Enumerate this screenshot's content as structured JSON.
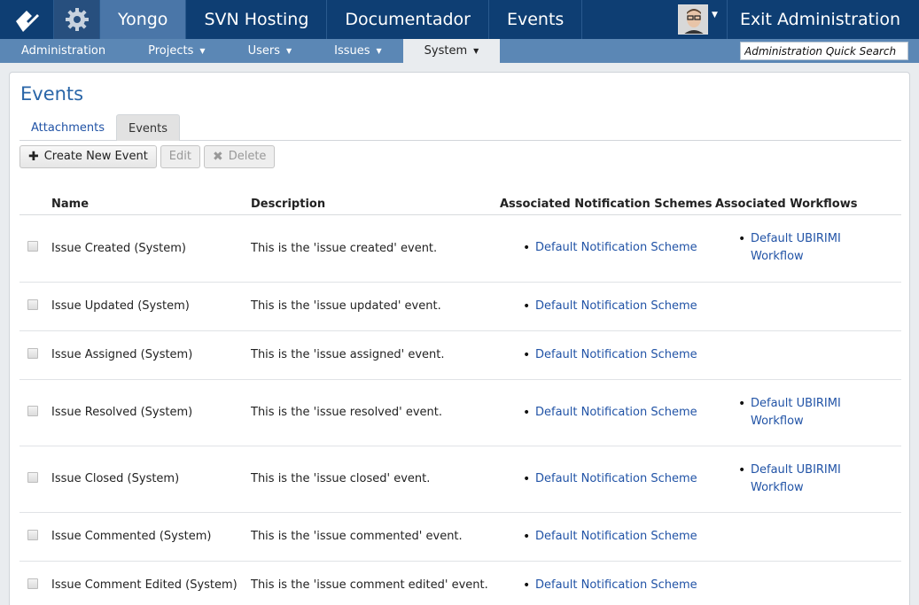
{
  "topbar": {
    "nav": [
      "Yongo",
      "SVN Hosting",
      "Documentador",
      "Events"
    ],
    "active_nav": "Yongo",
    "exit_label": "Exit Administration"
  },
  "subbar": {
    "items": [
      {
        "label": "Administration",
        "dropdown": false
      },
      {
        "label": "Projects",
        "dropdown": true
      },
      {
        "label": "Users",
        "dropdown": true
      },
      {
        "label": "Issues",
        "dropdown": true
      },
      {
        "label": "System",
        "dropdown": true,
        "active": true
      }
    ],
    "search_placeholder": "Administration Quick Search"
  },
  "page": {
    "title": "Events",
    "tabs": [
      {
        "label": "Attachments",
        "active": false
      },
      {
        "label": "Events",
        "active": true
      }
    ],
    "toolbar": {
      "create_label": "Create New Event",
      "edit_label": "Edit",
      "delete_label": "Delete"
    }
  },
  "table": {
    "headers": {
      "name": "Name",
      "description": "Description",
      "notification": "Associated Notification Schemes",
      "workflows": "Associated Workflows"
    },
    "rows": [
      {
        "name": "Issue Created (System)",
        "description": "This is the 'issue created' event.",
        "notification": "Default Notification Scheme",
        "workflow": "Default UBIRIMI Workflow"
      },
      {
        "name": "Issue Updated (System)",
        "description": "This is the 'issue updated' event.",
        "notification": "Default Notification Scheme",
        "workflow": ""
      },
      {
        "name": "Issue Assigned (System)",
        "description": "This is the 'issue assigned' event.",
        "notification": "Default Notification Scheme",
        "workflow": ""
      },
      {
        "name": "Issue Resolved (System)",
        "description": "This is the 'issue resolved' event.",
        "notification": "Default Notification Scheme",
        "workflow": "Default UBIRIMI Workflow"
      },
      {
        "name": "Issue Closed (System)",
        "description": "This is the 'issue closed' event.",
        "notification": "Default Notification Scheme",
        "workflow": "Default UBIRIMI Workflow"
      },
      {
        "name": "Issue Commented (System)",
        "description": "This is the 'issue commented' event.",
        "notification": "Default Notification Scheme",
        "workflow": ""
      },
      {
        "name": "Issue Comment Edited (System)",
        "description": "This is the 'issue comment edited' event.",
        "notification": "Default Notification Scheme",
        "workflow": ""
      }
    ]
  },
  "icons": {
    "logo": "ubirimi-logo-icon",
    "settings": "gear-icon",
    "create": "plus-icon",
    "delete": "x-icon"
  },
  "colors": {
    "topbar": "#0e3e73",
    "active_nav": "#4a76a8",
    "subbar": "#5b87b5",
    "link": "#2153a6",
    "title": "#2a66a8"
  }
}
